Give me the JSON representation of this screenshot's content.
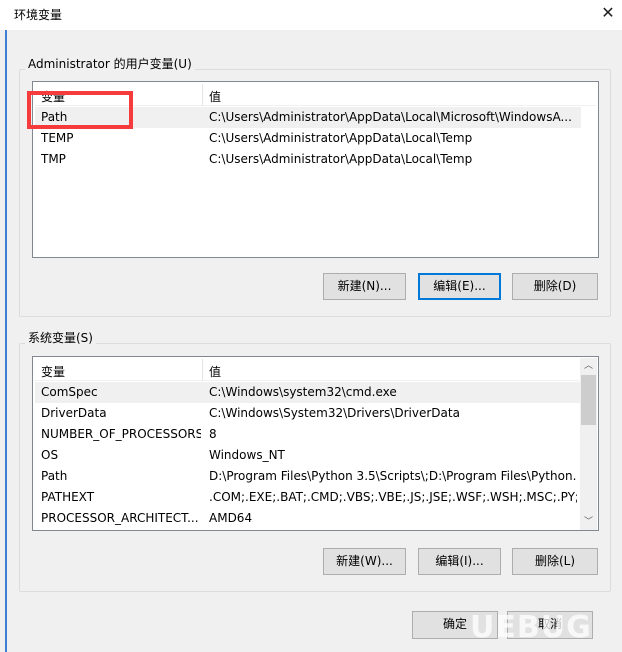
{
  "window": {
    "title": "环境变量",
    "close_icon": "close-icon"
  },
  "user_vars": {
    "legend": "Administrator 的用户变量(U)",
    "headers": [
      "变量",
      "值"
    ],
    "rows": [
      {
        "name": "Path",
        "value": "C:\\Users\\Administrator\\AppData\\Local\\Microsoft\\WindowsA..."
      },
      {
        "name": "TEMP",
        "value": "C:\\Users\\Administrator\\AppData\\Local\\Temp"
      },
      {
        "name": "TMP",
        "value": "C:\\Users\\Administrator\\AppData\\Local\\Temp"
      }
    ],
    "selected_row": 0,
    "buttons": {
      "new": "新建(N)...",
      "edit": "编辑(E)...",
      "delete": "删除(D)"
    }
  },
  "system_vars": {
    "legend": "系统变量(S)",
    "headers": [
      "变量",
      "值"
    ],
    "rows": [
      {
        "name": "ComSpec",
        "value": "C:\\Windows\\system32\\cmd.exe"
      },
      {
        "name": "DriverData",
        "value": "C:\\Windows\\System32\\Drivers\\DriverData"
      },
      {
        "name": "NUMBER_OF_PROCESSORS",
        "value": "8"
      },
      {
        "name": "OS",
        "value": "Windows_NT"
      },
      {
        "name": "Path",
        "value": "D:\\Program Files\\Python 3.5\\Scripts\\;D:\\Program Files\\Python..."
      },
      {
        "name": "PATHEXT",
        "value": ".COM;.EXE;.BAT;.CMD;.VBS;.VBE;.JS;.JSE;.WSF;.WSH;.MSC;.PY;.P..."
      },
      {
        "name": "PROCESSOR_ARCHITECT...",
        "value": "AMD64"
      }
    ],
    "selected_row": 0,
    "buttons": {
      "new": "新建(W)...",
      "edit": "编辑(I)...",
      "delete": "删除(L)"
    }
  },
  "footer": {
    "ok": "确定",
    "cancel": "取消"
  },
  "watermark": "UEBUG",
  "colors": {
    "highlight": "#f53b3b",
    "focus": "#0078d7"
  }
}
